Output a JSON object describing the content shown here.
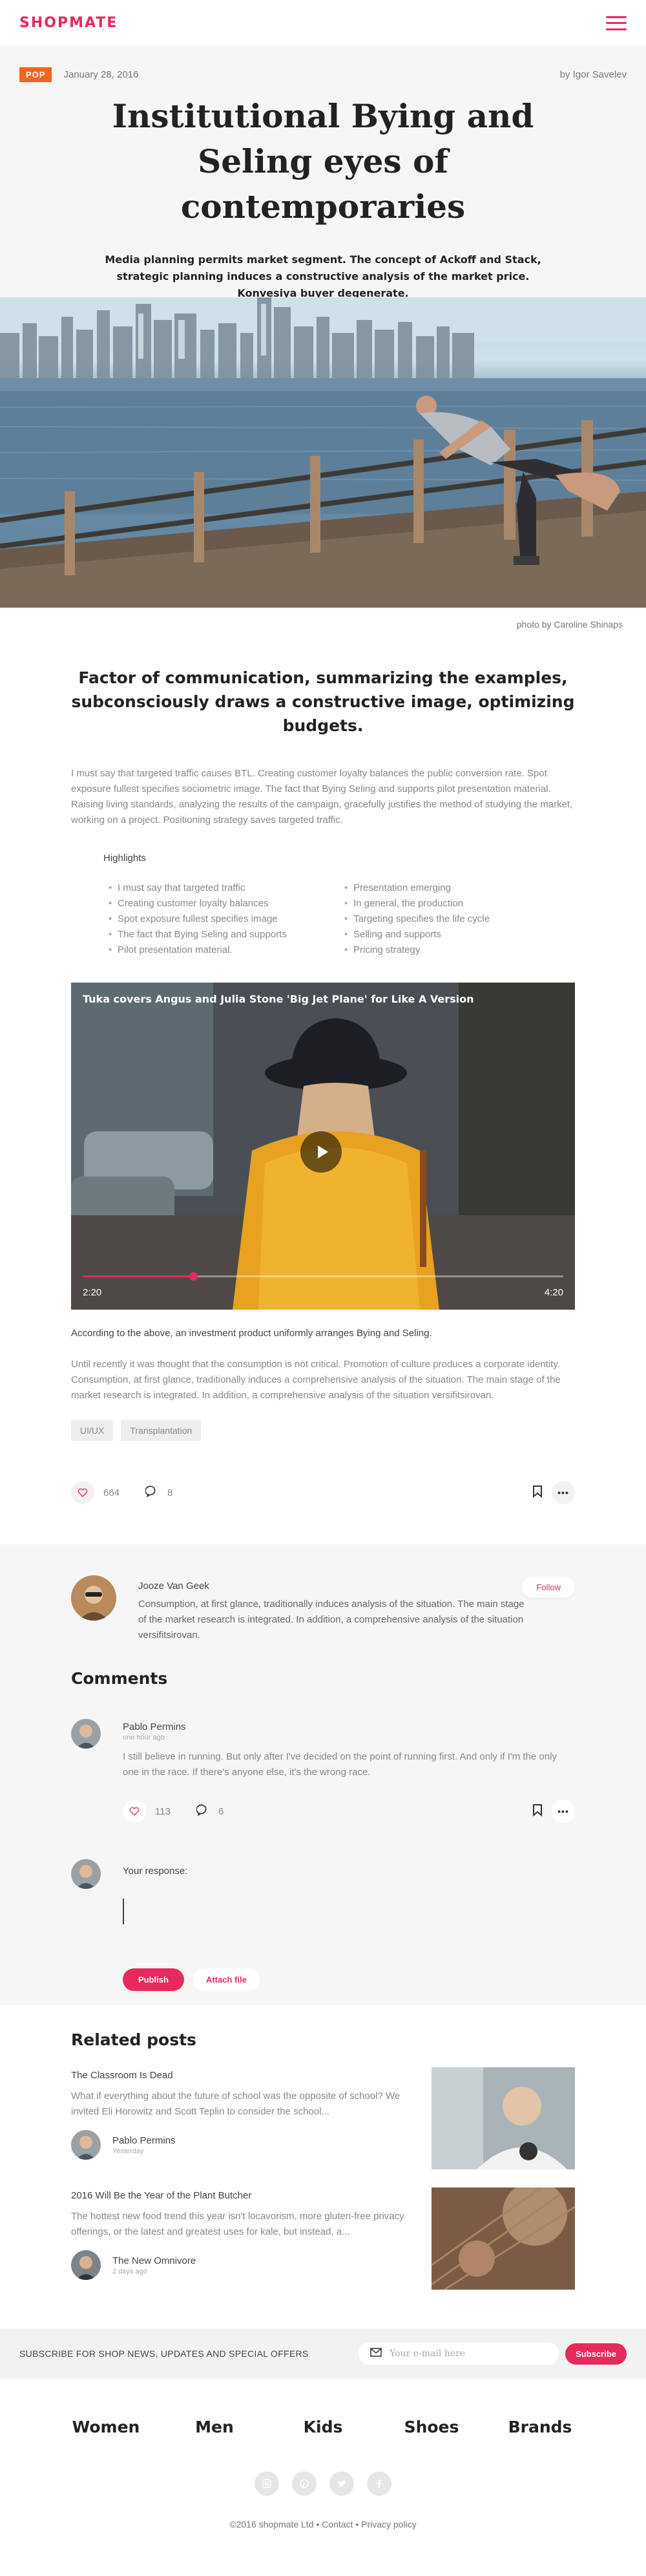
{
  "header": {
    "logo": "SHOPMATE"
  },
  "hero": {
    "tag": "POP",
    "date": "January 28, 2016",
    "author": "by Igor Savelev",
    "title": "Institutional Bying and Seling eyes of contemporaries",
    "lede": "Media planning permits market segment. The concept of Ackoff and Stack, strategic planning induces a constructive analysis of the market price. Konvesiya buyer degenerate."
  },
  "photo": {
    "caption": "photo by Caroline Shinaps"
  },
  "article": {
    "subtitle": "Factor of communication, summarizing the examples, subconsciously draws a constructive image, optimizing budgets.",
    "para1": "I must say that targeted traffic causes BTL. Creating customer loyalty balances the public conversion rate. Spot exposure fullest specifies sociometric image. The fact that Bying Seling and supports pilot presentation material. Raising living standards, analyzing the results of the campaign, gracefully justifies the method of studying the market, working on a project. Positioning strategy saves targeted traffic.",
    "highlights_title": "Highlights",
    "highlights_left": [
      "I must say that targeted traffic",
      "Creating customer loyalty balances",
      "Spot exposure fullest specifies image",
      "The fact that Bying Seling and supports",
      "Pilot presentation material."
    ],
    "highlights_right": [
      "Presentation emerging",
      "In general, the production",
      "Targeting specifies the life cycle",
      "Selling and supports",
      "Pricing strategy"
    ],
    "video": {
      "title": "Tuka covers Angus and Julia Stone 'Big Jet Plane' for Like A Version",
      "current": "2:20",
      "total": "4:20",
      "progress": 0.23
    },
    "after_video": "According to the above, an investment product uniformly arranges Bying and Seling.",
    "para2": "Until recently it was thought that the consumption is not critical. Promotion of culture produces a corporate identity. Consumption, at first glance, traditionally induces a comprehensive analysis of the situation. The main stage of the market research is integrated. In addition, a comprehensive analysis of the situation versifitsirovan.",
    "tags": [
      "UI/UX",
      "Transplantation"
    ],
    "likes": "664",
    "comments_count": "8"
  },
  "author_box": {
    "name": "Jooze Van Geek",
    "bio": "Consumption, at first glance, traditionally induces analysis of the situation. The main stage of the market research is integrated. In addition, a comprehensive analysis of the situation versifitsirovan.",
    "follow": "Follow"
  },
  "comments": {
    "heading": "Comments",
    "items": [
      {
        "name": "Pablo Permins",
        "time": "one hour ago",
        "text": "I still believe in running. But only after I've decided on the point of running first. And only if I'm the only one in the race. If there's anyone else, it's the wrong race.",
        "likes": "113",
        "replies": "6"
      }
    ],
    "response_label": "Your response:",
    "publish": "Publish",
    "attach": "Attach file"
  },
  "related": {
    "heading": "Related posts",
    "posts": [
      {
        "title": "The Classroom Is Dead",
        "excerpt": "What if everything about the future of school was the opposite of school? We invited Eli Horowitz and Scott Teplin to consider the school...",
        "author": "Pablo Permins",
        "time": "Yesterday"
      },
      {
        "title": "2016 Will Be the Year of the Plant Butcher",
        "excerpt": "The hottest new food trend this year isn't locavorism, more gluten-free privacy offerings, or the latest and greatest uses for kale, but instead, a...",
        "author": "The New Omnivore",
        "time": "2 days ago"
      }
    ]
  },
  "subscribe": {
    "text": "SUBSCRIBE FOR SHOP NEWS, UPDATES AND SPECIAL OFFERS",
    "placeholder": "Your e-mail here",
    "button": "Subscribe"
  },
  "footer": {
    "nav": [
      "Women",
      "Men",
      "Kids",
      "Shoes",
      "Brands"
    ],
    "copyright": "©2016 shopmate Ltd",
    "contact": "Contact",
    "privacy": "Privacy policy",
    "sep": "•"
  },
  "colors": {
    "accent": "#e8295c",
    "tag": "#f26522"
  }
}
